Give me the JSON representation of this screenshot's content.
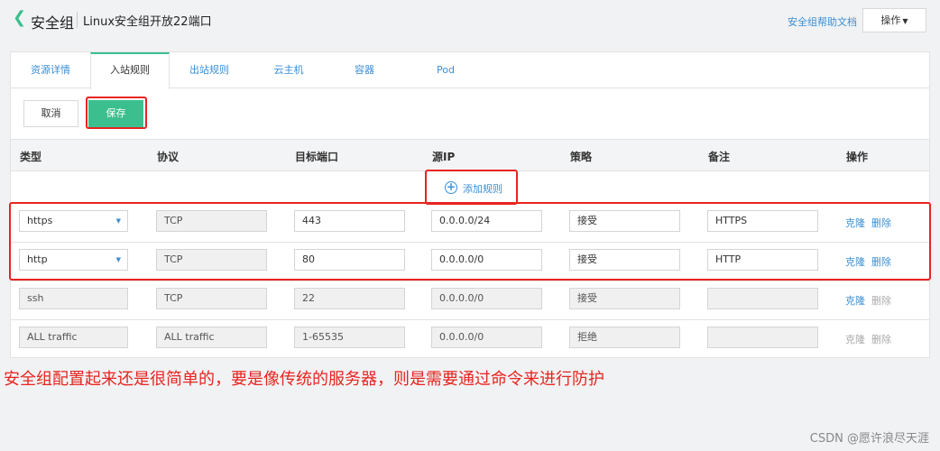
{
  "header": {
    "back_label": "安全组",
    "subtitle": "Linux安全组开放22端口",
    "help_link": "安全组帮助文档",
    "action_label": "操作"
  },
  "tabs": [
    {
      "label": "资源详情",
      "active": false
    },
    {
      "label": "入站规则",
      "active": true
    },
    {
      "label": "出站规则",
      "active": false
    },
    {
      "label": "云主机",
      "active": false
    },
    {
      "label": "容器",
      "active": false
    },
    {
      "label": "Pod",
      "active": false
    }
  ],
  "toolbar": {
    "cancel_label": "取消",
    "save_label": "保存"
  },
  "table": {
    "columns": [
      "类型",
      "协议",
      "目标端口",
      "源IP",
      "策略",
      "备注",
      "操作"
    ],
    "add_rule_label": "添加规则",
    "rows": [
      {
        "type": "https",
        "protocol": "TCP",
        "port": "443",
        "source_ip": "0.0.0.0/24",
        "policy": "接受",
        "note": "HTTPS",
        "clone": "克隆",
        "delete": "删除"
      },
      {
        "type": "http",
        "protocol": "TCP",
        "port": "80",
        "source_ip": "0.0.0.0/0",
        "policy": "接受",
        "note": "HTTP",
        "clone": "克隆",
        "delete": "删除"
      },
      {
        "type": "ssh",
        "protocol": "TCP",
        "port": "22",
        "source_ip": "0.0.0.0/0",
        "policy": "接受",
        "note": "",
        "clone": "克隆",
        "delete": "删除"
      },
      {
        "type": "ALL traffic",
        "protocol": "ALL traffic",
        "port": "1-65535",
        "source_ip": "0.0.0.0/0",
        "policy": "拒绝",
        "note": "",
        "clone": "克隆",
        "delete": "删除"
      }
    ]
  },
  "annotation": "安全组配置起来还是很简单的，要是像传统的服务器，则是需要通过命令来进行防护",
  "watermark": "CSDN @愿许浪尽天涯",
  "colors": {
    "accent": "#3cbf8f",
    "link": "#3a8fd6",
    "highlight": "#e8241f"
  }
}
